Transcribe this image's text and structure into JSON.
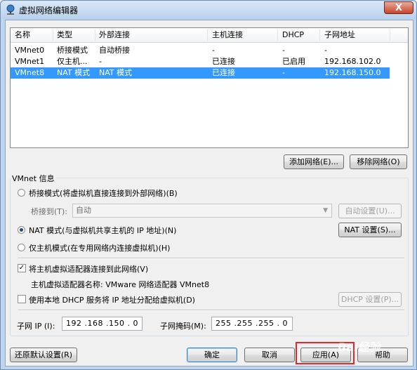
{
  "window": {
    "title": "虚拟网络编辑器",
    "close_label": "X"
  },
  "table": {
    "headers": [
      "名称",
      "类型",
      "外部连接",
      "主机连接",
      "DHCP",
      "子网地址"
    ],
    "rows": [
      [
        "VMnet0",
        "桥接模式",
        "自动桥接",
        "-",
        "-",
        "-"
      ],
      [
        "VMnet1",
        "仅主机...",
        "-",
        "已连接",
        "已启用",
        "192.168.102.0"
      ],
      [
        "VMnet8",
        "NAT 模式",
        "NAT 模式",
        "已连接",
        "-",
        "192.168.150.0"
      ]
    ],
    "selected_row": 2
  },
  "buttons": {
    "add_network": "添加网络(E)...",
    "remove_network": "移除网络(O)",
    "auto_settings": "自动设置(U)...",
    "nat_settings": "NAT 设置(S)...",
    "dhcp_settings": "DHCP 设置(P)...",
    "restore_defaults": "还原默认设置(R)",
    "ok": "确定",
    "cancel": "取消",
    "apply": "应用(A)",
    "help": "帮助"
  },
  "vmnet_info": {
    "group_label": "VMnet 信息",
    "bridge_mode": "桥接模式(将虚拟机直接连接到外部网络)(B)",
    "bridge_to_label": "桥接到(T):",
    "bridge_to_value": "自动",
    "nat_mode": "NAT 模式(与虚拟机共享主机的 IP 地址)(N)",
    "host_only_mode": "仅主机模式(在专用网络内连接虚拟机)(H)",
    "selected_mode": "nat",
    "connect_adapter": "将主机虚拟适配器连接到此网络(V)",
    "connect_adapter_checked": true,
    "adapter_name": "主机虚拟适配器名称: VMware 网络适配器 VMnet8",
    "use_dhcp": "使用本地 DHCP 服务将 IP 地址分配给虚拟机(D)",
    "use_dhcp_checked": false,
    "subnet_ip_label": "子网 IP (I):",
    "subnet_ip_value": "192 .168 .150 .  0",
    "subnet_mask_label": "子网掩码(M):",
    "subnet_mask_value": "255 .255 .255 .  0"
  },
  "watermark": "Bai经验"
}
